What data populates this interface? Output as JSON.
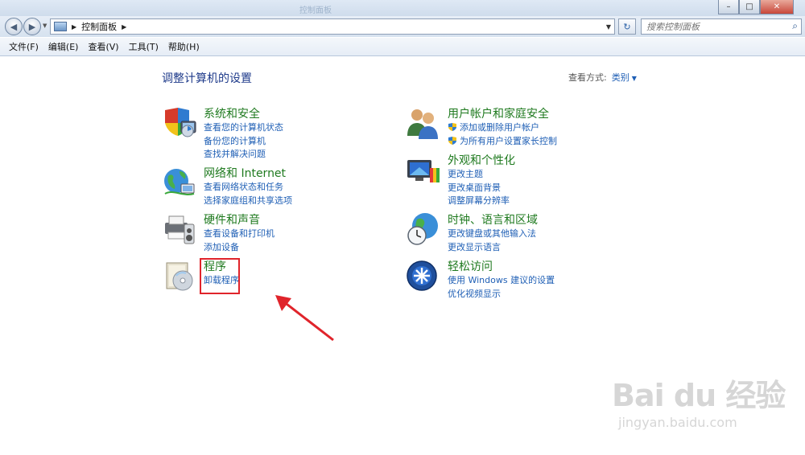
{
  "window": {
    "ghost_title": "控制面板",
    "controls": {
      "minimize": "–",
      "maximize": "□",
      "close": "✕"
    }
  },
  "nav": {
    "back_icon": "back-arrow-icon",
    "forward_icon": "forward-arrow-icon",
    "breadcrumb": "控制面板",
    "search_placeholder": "搜索控制面板"
  },
  "menu": {
    "items": [
      "文件(F)",
      "编辑(E)",
      "查看(V)",
      "工具(T)",
      "帮助(H)"
    ]
  },
  "main": {
    "title": "调整计算机的设置",
    "view_by_label": "查看方式:",
    "view_by_value": "类别",
    "categories": [
      {
        "heading": "系统和安全",
        "icon": "shield-computer-icon",
        "links": [
          "查看您的计算机状态",
          "备份您的计算机",
          "查找并解决问题"
        ]
      },
      {
        "heading": "网络和 Internet",
        "icon": "network-globe-icon",
        "links": [
          "查看网络状态和任务",
          "选择家庭组和共享选项"
        ]
      },
      {
        "heading": "硬件和声音",
        "icon": "printer-speaker-icon",
        "links": [
          "查看设备和打印机",
          "添加设备"
        ]
      },
      {
        "heading": "程序",
        "icon": "programs-disc-icon",
        "links": [
          "卸载程序"
        ]
      },
      {
        "heading": "用户帐户和家庭安全",
        "icon": "users-icon",
        "links": [
          "添加或删除用户帐户",
          "为所有用户设置家长控制"
        ]
      },
      {
        "heading": "外观和个性化",
        "icon": "monitor-paint-icon",
        "links": [
          "更改主题",
          "更改桌面背景",
          "调整屏幕分辨率"
        ]
      },
      {
        "heading": "时钟、语言和区域",
        "icon": "clock-globe-icon",
        "links": [
          "更改键盘或其他输入法",
          "更改显示语言"
        ]
      },
      {
        "heading": "轻松访问",
        "icon": "ease-of-access-icon",
        "links": [
          "使用 Windows 建议的设置",
          "优化视频显示"
        ]
      }
    ]
  },
  "annotation": {
    "color": "#e0242b"
  },
  "watermark": {
    "brand": "Bai du 经验",
    "url": "jingyan.baidu.com"
  },
  "colors": {
    "heading": "#1f7a1f",
    "link": "#1f5fb5",
    "title": "#1e3a8a"
  }
}
